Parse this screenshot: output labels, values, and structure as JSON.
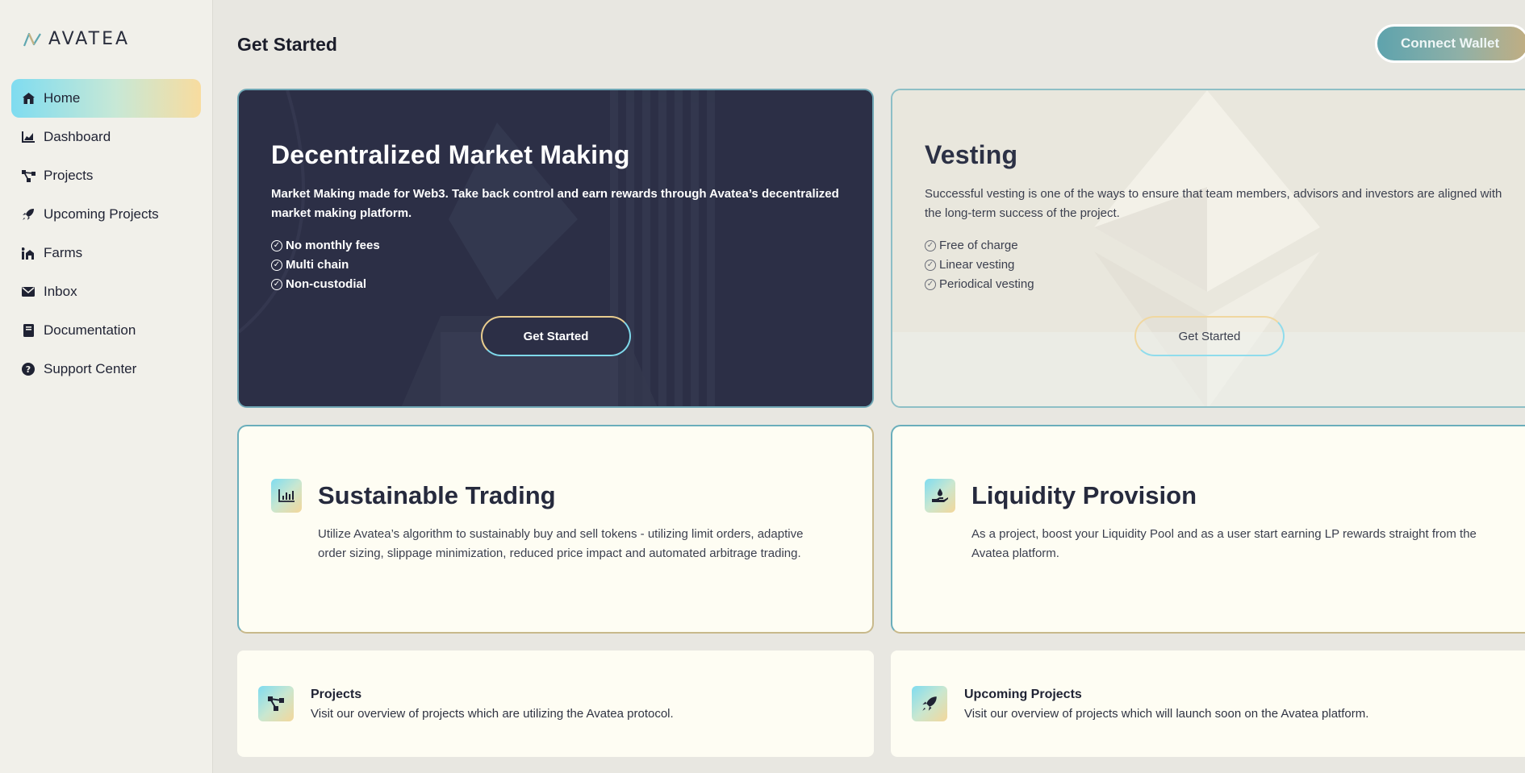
{
  "brand": {
    "name": "AVATEA"
  },
  "sidebar": {
    "items": [
      {
        "label": "Home",
        "icon": "home-icon",
        "active": true
      },
      {
        "label": "Dashboard",
        "icon": "chart-icon"
      },
      {
        "label": "Projects",
        "icon": "nodes-icon"
      },
      {
        "label": "Upcoming Projects",
        "icon": "rocket-icon"
      },
      {
        "label": "Farms",
        "icon": "farm-icon"
      },
      {
        "label": "Inbox",
        "icon": "envelope-icon"
      },
      {
        "label": "Documentation",
        "icon": "book-icon"
      },
      {
        "label": "Support Center",
        "icon": "question-icon"
      }
    ]
  },
  "header": {
    "title": "Get Started",
    "connect_label": "Connect Wallet"
  },
  "market_making": {
    "title": "Decentralized Market Making",
    "description": "Market Making made for Web3. Take back control and earn rewards through Avatea’s decentralized market making platform.",
    "features": [
      "No monthly fees",
      "Multi chain",
      "Non-custodial"
    ],
    "button_label": "Get Started"
  },
  "vesting": {
    "title": "Vesting",
    "description": "Successful vesting is one of the ways to ensure that team members, advisors and investors are aligned with the long-term success of the project.",
    "features": [
      "Free of charge",
      "Linear vesting",
      "Periodical vesting"
    ],
    "button_label": "Get Started"
  },
  "sustainable_trading": {
    "title": "Sustainable Trading",
    "description": "Utilize Avatea’s algorithm to sustainably buy and sell tokens - utilizing limit orders, adaptive order sizing, slippage minimization, reduced price impact and automated arbitrage trading.",
    "icon": "bar-chart-icon"
  },
  "liquidity": {
    "title": "Liquidity Provision",
    "description": "As a project, boost your Liquidity Pool and as a user start earning LP rewards straight from the Avatea platform.",
    "icon": "hand-drop-icon"
  },
  "projects_card": {
    "title": "Projects",
    "description": "Visit our overview of projects which are utilizing the Avatea protocol.",
    "icon": "nodes-icon"
  },
  "upcoming_card": {
    "title": "Upcoming Projects",
    "description": "Visit our overview of projects which will launch soon on the Avatea platform.",
    "icon": "rocket-icon"
  },
  "colors": {
    "dark_card": "#2c2f46",
    "accent_cyan": "#7fdcf0",
    "accent_gold": "#f8dc9f",
    "page_bg": "#e8e7e1"
  }
}
